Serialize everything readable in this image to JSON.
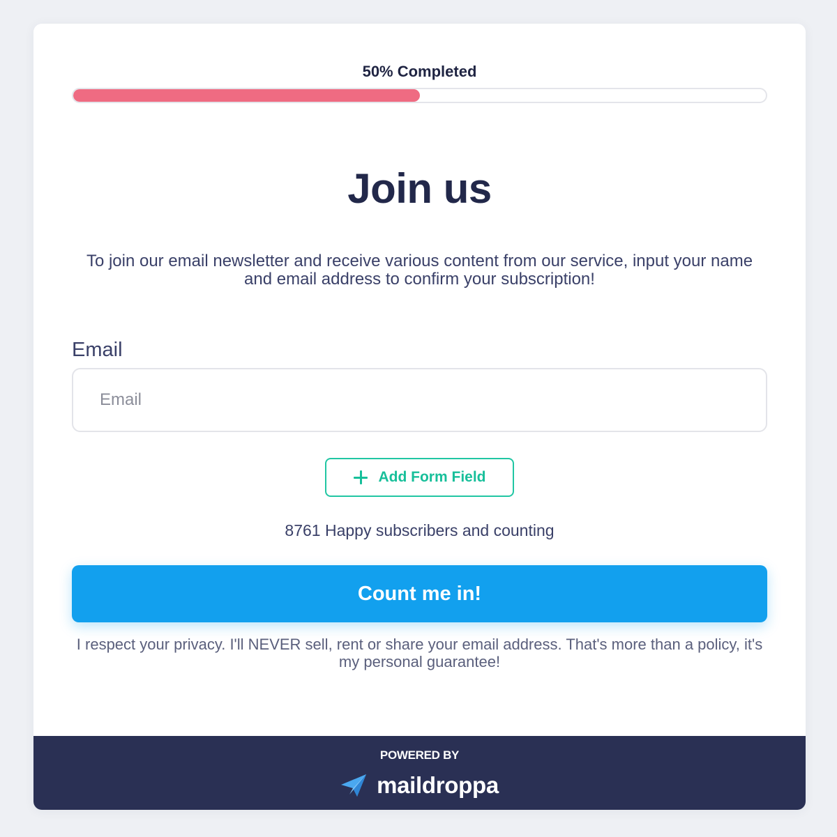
{
  "progress": {
    "label": "50% Completed",
    "percent": 50,
    "fill_color": "#ef6b82"
  },
  "form": {
    "title": "Join us",
    "description": "To join our email newsletter and receive various content from our service, input your name and email address to confirm your subscription!",
    "email_label": "Email",
    "email_placeholder": "Email",
    "email_value": "",
    "add_field_label": "Add Form Field",
    "add_field_icon": "plus-icon",
    "subscriber_count": "8761 Happy subscribers and counting",
    "submit_label": "Count me in!",
    "privacy_note": "I respect your privacy. I'll NEVER sell, rent or share your email address. That's more than a policy, it's my personal guarantee!"
  },
  "footer": {
    "powered_by": "POWERED BY",
    "brand_name": "maildroppa",
    "brand_icon": "paper-plane-icon"
  },
  "colors": {
    "accent_blue": "#12a0ee",
    "accent_green": "#17bf9a",
    "progress_pink": "#ef6b82",
    "footer_navy": "#2a3054",
    "text_dark": "#22284a"
  }
}
